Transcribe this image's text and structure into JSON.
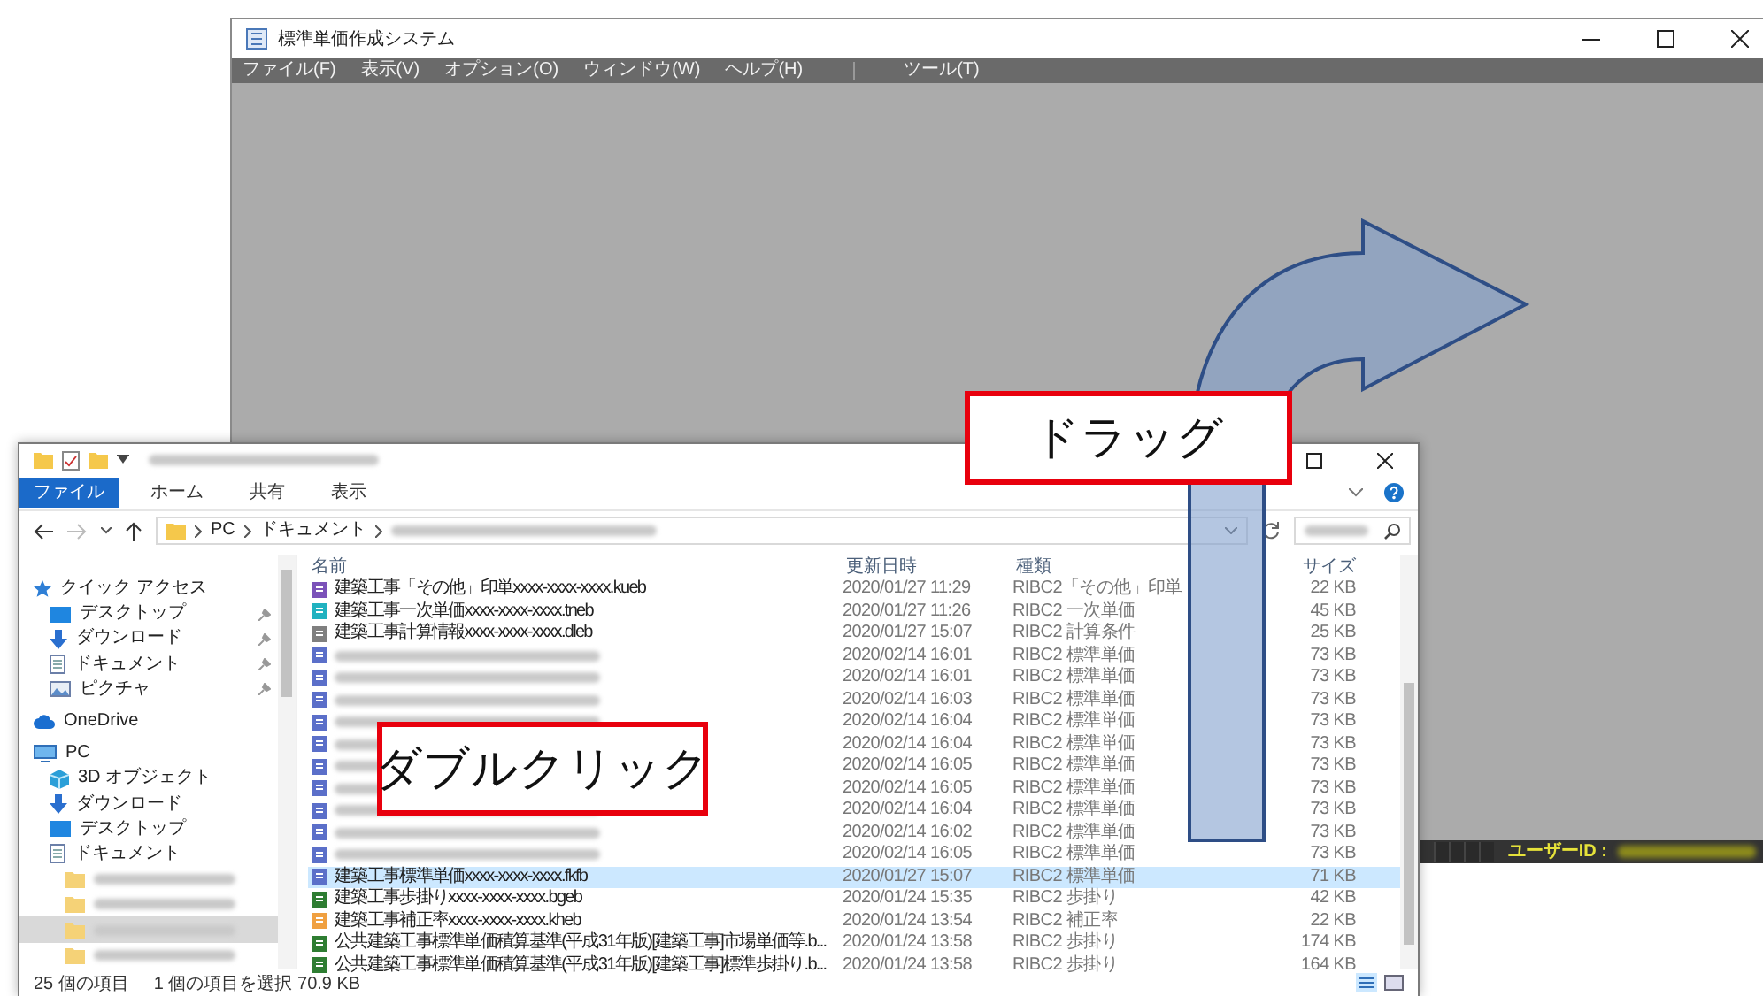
{
  "app_window": {
    "title": "標準単価作成システム",
    "menu": [
      "ファイル(F)",
      "表示(V)",
      "オプション(O)",
      "ウィンドウ(W)",
      "ヘルプ(H)"
    ],
    "tool_menu": "ツール(T)",
    "status_label": "ユーザーID :"
  },
  "explorer": {
    "ribbon_tabs": [
      {
        "label": "ファイル",
        "selected": true
      },
      {
        "label": "ホーム",
        "selected": false
      },
      {
        "label": "共有",
        "selected": false
      },
      {
        "label": "表示",
        "selected": false
      }
    ],
    "breadcrumbs": [
      "PC",
      "ドキュメント"
    ],
    "columns": [
      "名前",
      "更新日時",
      "種類",
      "サイズ"
    ],
    "navigation": [
      {
        "label": "クイック アクセス",
        "kind": "star",
        "selected": false,
        "children": [
          {
            "label": "デスクトップ",
            "kind": "desktop",
            "pinned": true,
            "selected": false
          },
          {
            "label": "ダウンロード",
            "kind": "download",
            "pinned": true,
            "selected": false
          },
          {
            "label": "ドキュメント",
            "kind": "document",
            "pinned": true,
            "selected": false
          },
          {
            "label": "ピクチャ",
            "kind": "picture",
            "pinned": true,
            "selected": false
          }
        ]
      },
      {
        "label": "OneDrive",
        "kind": "cloud",
        "selected": false
      },
      {
        "label": "PC",
        "kind": "pc",
        "selected": false,
        "children": [
          {
            "label": "3D オブジェクト",
            "kind": "cube",
            "selected": false
          },
          {
            "label": "ダウンロード",
            "kind": "download",
            "selected": false
          },
          {
            "label": "デスクトップ",
            "kind": "desktop",
            "selected": false
          },
          {
            "label": "ドキュメント",
            "kind": "document",
            "selected": false,
            "children": [
              {
                "kind": "folder",
                "selected": false
              },
              {
                "kind": "folder",
                "selected": false
              },
              {
                "kind": "folder",
                "selected": true
              },
              {
                "kind": "folder",
                "selected": false
              }
            ]
          }
        ]
      }
    ],
    "files": [
      {
        "kind": "file",
        "name": "建築工事「その他」印単xxxx-xxxx-xxxx.kueb",
        "date": "2020/01/27 11:29",
        "type": "RIBC2「その他」印単",
        "size": "22 KB",
        "color": "#7b52b9",
        "selected": false
      },
      {
        "kind": "file",
        "name": "建築工事一次単価xxxx-xxxx-xxxx.tneb",
        "date": "2020/01/27 11:26",
        "type": "RIBC2 一次単価",
        "size": "45 KB",
        "color": "#20b2c0",
        "selected": false
      },
      {
        "kind": "file",
        "name": "建築工事計算情報xxxx-xxxx-xxxx.dleb",
        "date": "2020/01/27 15:07",
        "type": "RIBC2 計算条件",
        "size": "25 KB",
        "color": "#7f7f7f",
        "selected": false
      },
      {
        "kind": "redacted",
        "date": "2020/02/14 16:01",
        "type": "RIBC2 標準単価",
        "size": "73 KB",
        "color": "#5b6fc9",
        "selected": false
      },
      {
        "kind": "redacted",
        "date": "2020/02/14 16:01",
        "type": "RIBC2 標準単価",
        "size": "73 KB",
        "color": "#5b6fc9",
        "selected": false
      },
      {
        "kind": "redacted",
        "date": "2020/02/14 16:03",
        "type": "RIBC2 標準単価",
        "size": "73 KB",
        "color": "#5b6fc9",
        "selected": false
      },
      {
        "kind": "redacted",
        "date": "2020/02/14 16:04",
        "type": "RIBC2 標準単価",
        "size": "73 KB",
        "color": "#5b6fc9",
        "selected": false
      },
      {
        "kind": "redacted",
        "date": "2020/02/14 16:04",
        "type": "RIBC2 標準単価",
        "size": "73 KB",
        "color": "#5b6fc9",
        "selected": false
      },
      {
        "kind": "redacted",
        "date": "2020/02/14 16:05",
        "type": "RIBC2 標準単価",
        "size": "73 KB",
        "color": "#5b6fc9",
        "selected": false
      },
      {
        "kind": "redacted",
        "date": "2020/02/14 16:05",
        "type": "RIBC2 標準単価",
        "size": "73 KB",
        "color": "#5b6fc9",
        "selected": false
      },
      {
        "kind": "redacted",
        "date": "2020/02/14 16:04",
        "type": "RIBC2 標準単価",
        "size": "73 KB",
        "color": "#5b6fc9",
        "selected": false
      },
      {
        "kind": "redacted",
        "date": "2020/02/14 16:02",
        "type": "RIBC2 標準単価",
        "size": "73 KB",
        "color": "#5b6fc9",
        "selected": false
      },
      {
        "kind": "redacted",
        "date": "2020/02/14 16:05",
        "type": "RIBC2 標準単価",
        "size": "73 KB",
        "color": "#5b6fc9",
        "selected": false
      },
      {
        "kind": "file",
        "name": "建築工事標準単価xxxx-xxxx-xxxx.fkfb",
        "date": "2020/01/27 15:07",
        "type": "RIBC2 標準単価",
        "size": "71 KB",
        "color": "#5b6fc9",
        "selected": true
      },
      {
        "kind": "file",
        "name": "建築工事歩掛りxxxx-xxxx-xxxx.bgeb",
        "date": "2020/01/24 15:35",
        "type": "RIBC2 歩掛り",
        "size": "42 KB",
        "color": "#2e7d32",
        "selected": false
      },
      {
        "kind": "file",
        "name": "建築工事補正率xxxx-xxxx-xxxx.kheb",
        "date": "2020/01/24 13:54",
        "type": "RIBC2 補正率",
        "size": "22 KB",
        "color": "#f0a040",
        "selected": false
      },
      {
        "kind": "file",
        "name": "公共建築工事標準単価積算基準(平成31年版)[建築工事]市場単価等.b...",
        "date": "2020/01/24 13:58",
        "type": "RIBC2 歩掛り",
        "size": "174 KB",
        "color": "#2e7d32",
        "selected": false
      },
      {
        "kind": "file",
        "name": "公共建築工事標準単価積算基準(平成31年版)[建築工事]標準歩掛り.b...",
        "date": "2020/01/24 13:58",
        "type": "RIBC2 歩掛り",
        "size": "164 KB",
        "color": "#2e7d32",
        "selected": false
      }
    ],
    "status": {
      "count": "25 個の項目",
      "selection": "1 個の項目を選択  70.9 KB"
    }
  },
  "callouts": [
    {
      "text": "ドラッグ"
    },
    {
      "text": "ダブルクリック"
    }
  ]
}
